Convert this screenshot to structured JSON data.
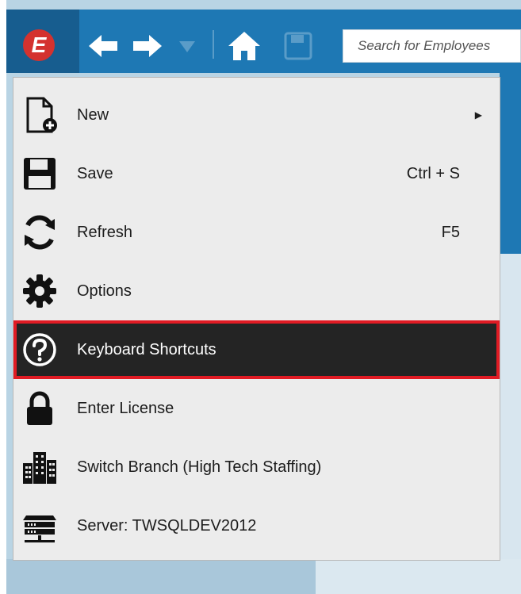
{
  "toolbar": {
    "logo_letter": "E",
    "search_placeholder": "Search for Employees",
    "icons": [
      "back-arrow-icon",
      "forward-arrow-icon",
      "dropdown-triangle-icon",
      "home-icon",
      "save-icon"
    ]
  },
  "menu": {
    "items": [
      {
        "label": "New",
        "shortcut": "",
        "icon": "new-document-icon",
        "submenu": true
      },
      {
        "label": "Save",
        "shortcut": "Ctrl + S",
        "icon": "save-icon"
      },
      {
        "label": "Refresh",
        "shortcut": "F5",
        "icon": "refresh-icon"
      },
      {
        "label": "Options",
        "shortcut": "",
        "icon": "gear-icon"
      },
      {
        "label": "Keyboard Shortcuts",
        "shortcut": "",
        "icon": "help-icon",
        "selected": true
      },
      {
        "label": "Enter License",
        "shortcut": "",
        "icon": "lock-icon"
      },
      {
        "label": "Switch Branch (High Tech Staffing)",
        "shortcut": "",
        "icon": "buildings-icon"
      },
      {
        "label": "Server: TWSQLDEV2012",
        "shortcut": "",
        "icon": "server-icon"
      }
    ],
    "submenu_arrow": "▶"
  },
  "colors": {
    "toolbar_blue": "#1e78b4",
    "logo_red": "#d4322f",
    "selected_bg": "#242424",
    "selected_outline": "#e01b24"
  }
}
